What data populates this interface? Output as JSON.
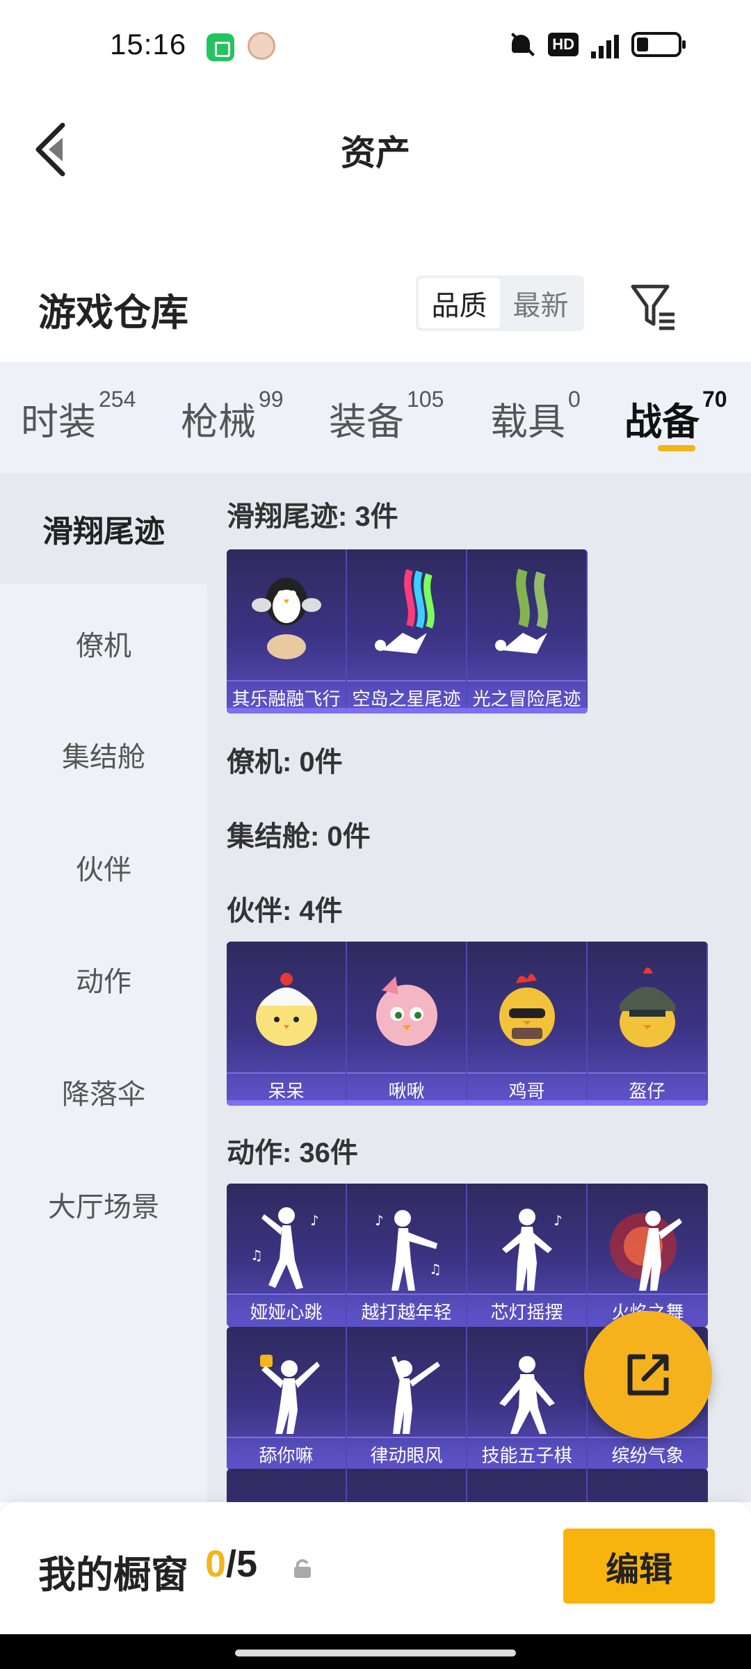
{
  "status_bar": {
    "time": "15:16",
    "hd": "HD",
    "network": "4G"
  },
  "header": {
    "title": "资产"
  },
  "warehouse": {
    "title": "游戏仓库",
    "sort_options": [
      "品质",
      "最新"
    ],
    "active_sort": "品质"
  },
  "tabs": [
    {
      "label": "时装",
      "count": "254"
    },
    {
      "label": "枪械",
      "count": "99"
    },
    {
      "label": "装备",
      "count": "105"
    },
    {
      "label": "载具",
      "count": "0"
    },
    {
      "label": "战备",
      "count": "70",
      "active": true
    }
  ],
  "sidenav": [
    {
      "label": "滑翔尾迹",
      "active": true
    },
    {
      "label": "僚机"
    },
    {
      "label": "集结舱"
    },
    {
      "label": "伙伴"
    },
    {
      "label": "动作"
    },
    {
      "label": "降落伞"
    },
    {
      "label": "大厅场景"
    }
  ],
  "sections": {
    "glide": {
      "label": "滑翔尾迹: 3件",
      "items": [
        "其乐融融飞行",
        "空岛之星尾迹",
        "光之冒险尾迹"
      ]
    },
    "wingman": {
      "label": "僚机: 0件"
    },
    "pod": {
      "label": "集结舱: 0件"
    },
    "partner": {
      "label": "伙伴: 4件",
      "items": [
        "呆呆",
        "啾啾",
        "鸡哥",
        "盔仔"
      ]
    },
    "action": {
      "label": "动作: 36件",
      "row1": [
        "娅娅心跳",
        "越打越年轻",
        "芯灯摇摆",
        "火焰之舞"
      ],
      "row2": [
        "舔你嘛",
        "律动眼风",
        "技能五子棋",
        "缤纷气象"
      ]
    }
  },
  "bottom_bar": {
    "label": "我的橱窗",
    "current": "0",
    "total": "/5",
    "edit_label": "编辑"
  },
  "colors": {
    "accent": "#f5b41a",
    "card_bg": "#3c3485",
    "card_caption": "#5c52c7"
  },
  "icons": [
    "back-icon",
    "filter-icon",
    "share-icon",
    "lock-icon",
    "bell-off-icon",
    "battery-icon"
  ]
}
